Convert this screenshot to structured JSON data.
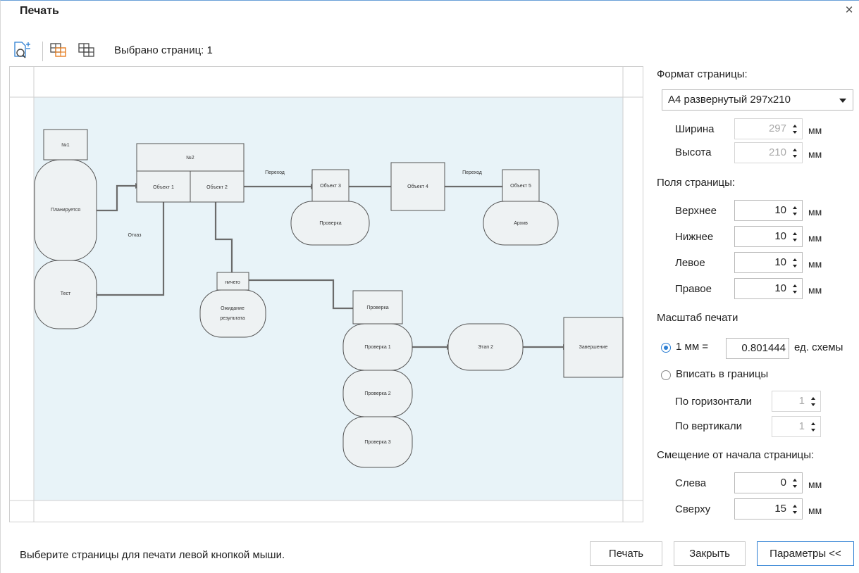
{
  "window": {
    "title": "Печать",
    "close_glyph": "×"
  },
  "toolbar": {
    "icons": [
      "zoom-page-icon",
      "select-pages-icon",
      "all-pages-icon"
    ],
    "selected_label": "Выбрано страниц: 1"
  },
  "diagram": {
    "nodes": {
      "n1": "№1",
      "n2": "№2",
      "plan": "Планируется",
      "test": "Тест",
      "obj1": "Объект 1",
      "obj2": "Объект 2",
      "obj3": "Объект 3",
      "obj4": "Объект 4",
      "obj5": "Объект 5",
      "check": "Проверка",
      "archive": "Архив",
      "nothing": "ничего",
      "wait1": "Ожидание",
      "wait2": "результата",
      "check_head": "Проверка",
      "check1": "Проверка 1",
      "check2": "Проверка 2",
      "check3": "Проверка 3",
      "stage2": "Этап 2",
      "finish": "Завершение"
    },
    "edges": {
      "transition1": "Переход",
      "transition2": "Переход",
      "refusal": "Отказ"
    }
  },
  "settings": {
    "page_format_label": "Формат страницы:",
    "page_format_value": "А4 развернутый 297x210",
    "width_label": "Ширина",
    "width_value": "297",
    "height_label": "Высота",
    "height_value": "210",
    "unit": "мм",
    "margins_label": "Поля страницы:",
    "top_label": "Верхнее",
    "top_value": "10",
    "bottom_label": "Нижнее",
    "bottom_value": "10",
    "left_label": "Левое",
    "left_value": "10",
    "right_label": "Правое",
    "right_value": "10",
    "scale_label": "Масштаб печати",
    "scale_radio_label": "1 мм =",
    "scale_value": "0.801444",
    "scale_unit": "ед. схемы",
    "fit_label": "Вписать в границы",
    "horiz_label": "По горизонтали",
    "horiz_value": "1",
    "vert_label": "По вертикали",
    "vert_value": "1",
    "offset_label": "Смещение от начала страницы:",
    "offset_left_label": "Слева",
    "offset_left_value": "0",
    "offset_top_label": "Сверху",
    "offset_top_value": "15"
  },
  "footer": {
    "status": "Выберите страницы для печати левой кнопкой мыши.",
    "print_btn": "Печать",
    "close_btn": "Закрыть",
    "params_btn": "Параметры <<"
  }
}
